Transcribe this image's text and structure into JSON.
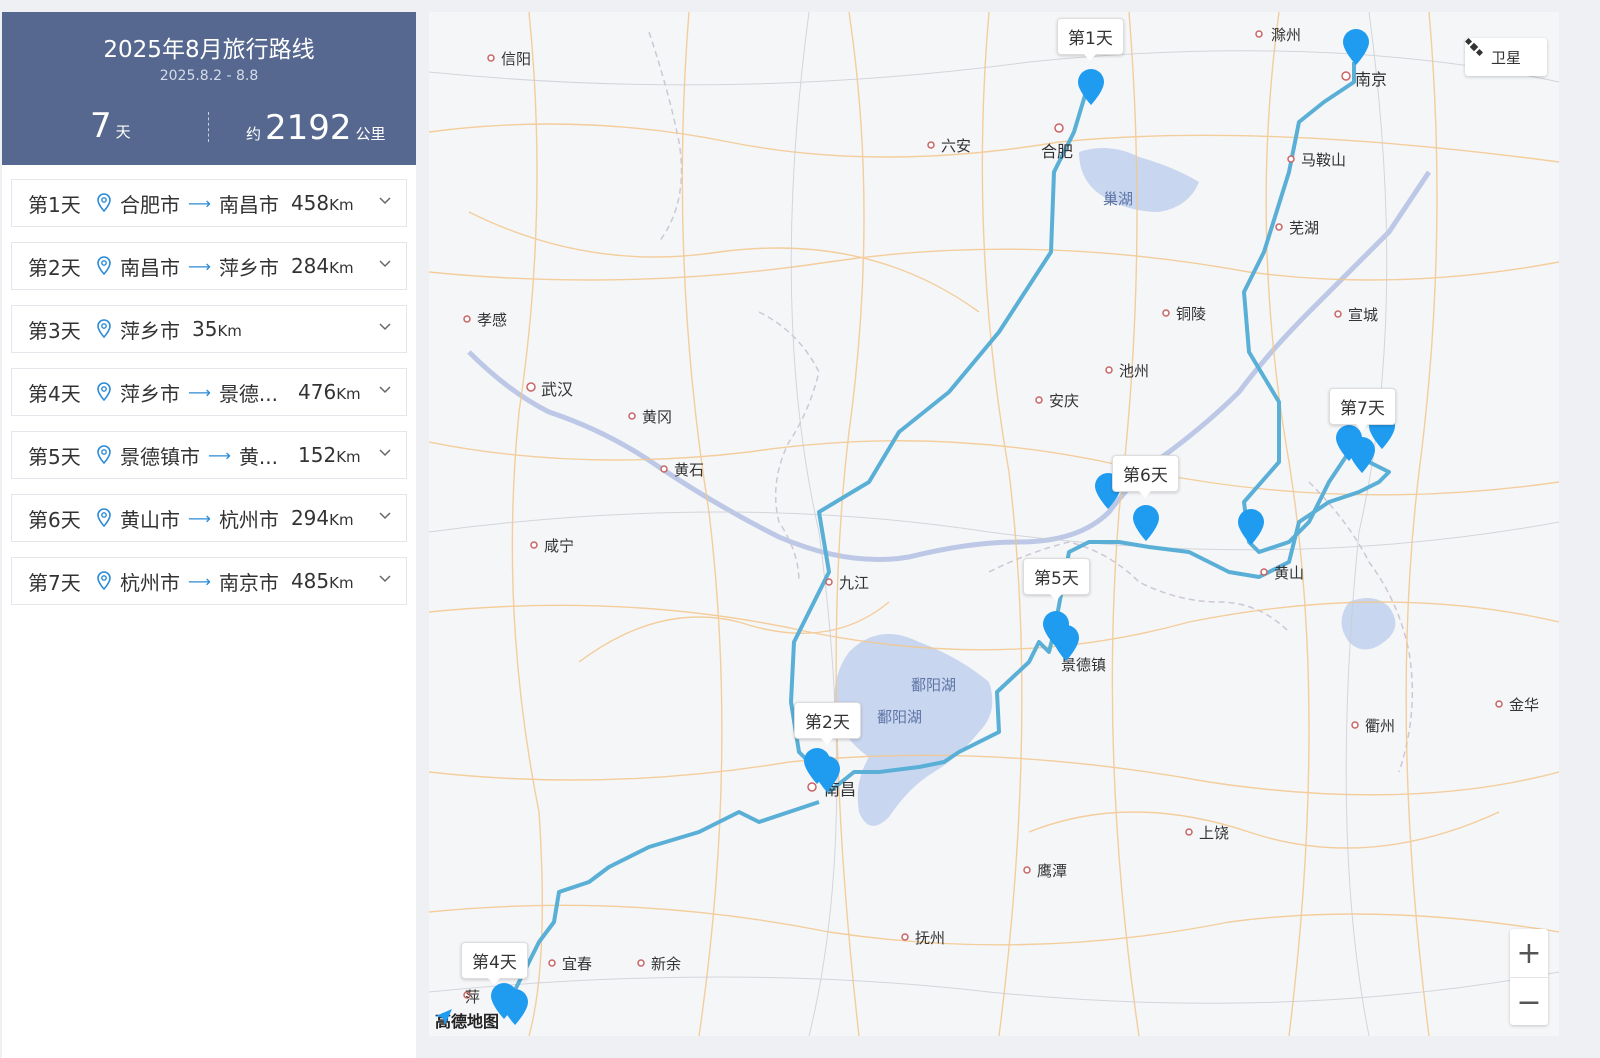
{
  "summary": {
    "title": "2025年8月旅行路线",
    "dates": "2025.8.2 - 8.8",
    "days_value": "7",
    "days_unit": "天",
    "distance_prefix": "约",
    "distance_value": "2192",
    "distance_unit": "公里"
  },
  "days": [
    {
      "label": "第1天",
      "from": "合肥市",
      "arrow": "⟶",
      "to": "南昌市",
      "km": "458",
      "unit": "Km"
    },
    {
      "label": "第2天",
      "from": "南昌市",
      "arrow": "⟶",
      "to": "萍乡市",
      "km": "284",
      "unit": "Km"
    },
    {
      "label": "第3天",
      "from": "萍乡市",
      "arrow": "",
      "to": "",
      "km": "35",
      "unit": "Km"
    },
    {
      "label": "第4天",
      "from": "萍乡市",
      "arrow": "⟶",
      "to": "景德...",
      "km": "476",
      "unit": "Km"
    },
    {
      "label": "第5天",
      "from": "景德镇市",
      "arrow": "⟶",
      "to": "黄...",
      "km": "152",
      "unit": "Km"
    },
    {
      "label": "第6天",
      "from": "黄山市",
      "arrow": "⟶",
      "to": "杭州市",
      "km": "294",
      "unit": "Km"
    },
    {
      "label": "第7天",
      "from": "杭州市",
      "arrow": "⟶",
      "to": "南京市",
      "km": "485",
      "unit": "Km"
    }
  ],
  "map": {
    "cities": [
      "信阳",
      "滁州",
      "南京",
      "合肥",
      "六安",
      "马鞍山",
      "芜湖",
      "孝感",
      "铜陵",
      "宣城",
      "武汉",
      "池州",
      "安庆",
      "黄冈",
      "黄石",
      "黄山",
      "咸宁",
      "九江",
      "景德镇",
      "金华",
      "衢州",
      "南昌",
      "上饶",
      "鹰潭",
      "抚州",
      "宜春",
      "新余",
      "萍"
    ],
    "lakes": [
      "巢湖",
      "鄱阳湖",
      "鄱阳湖"
    ],
    "day_tags": [
      "第1天",
      "第2天",
      "第4天",
      "第5天",
      "第6天",
      "第7天"
    ],
    "satellite_label": "卫星",
    "zoom_in": "+",
    "zoom_out": "−",
    "logo": "高德地图",
    "route_color": "#5aafd6",
    "marker_color": "#1f9bf0"
  }
}
